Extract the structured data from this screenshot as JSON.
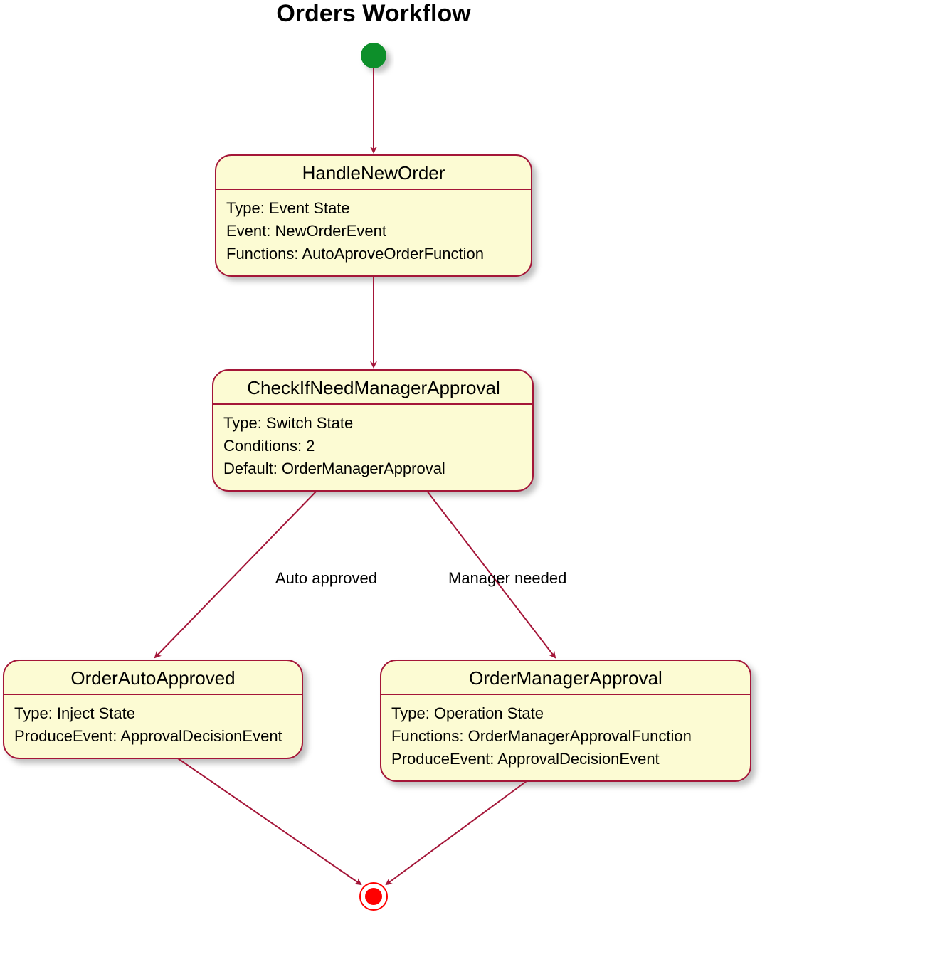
{
  "title": "Orders Workflow",
  "states": {
    "handleNewOrder": {
      "name": "HandleNewOrder",
      "lines": [
        "Type: Event State",
        "Event: NewOrderEvent",
        "Functions: AutoAproveOrderFunction"
      ]
    },
    "checkApproval": {
      "name": "CheckIfNeedManagerApproval",
      "lines": [
        "Type: Switch State",
        "Conditions: 2",
        "Default: OrderManagerApproval"
      ]
    },
    "autoApproved": {
      "name": "OrderAutoApproved",
      "lines": [
        "Type: Inject State",
        "ProduceEvent: ApprovalDecisionEvent"
      ]
    },
    "managerApproval": {
      "name": "OrderManagerApproval",
      "lines": [
        "Type: Operation State",
        "Functions: OrderManagerApprovalFunction",
        "ProduceEvent: ApprovalDecisionEvent"
      ]
    }
  },
  "edgeLabels": {
    "autoApproved": "Auto approved",
    "managerNeeded": "Manager needed"
  },
  "colors": {
    "stateFill": "#FCFBD3",
    "stroke": "#A41538",
    "startFill": "#0E8F29",
    "endFill": "#FF0000"
  }
}
